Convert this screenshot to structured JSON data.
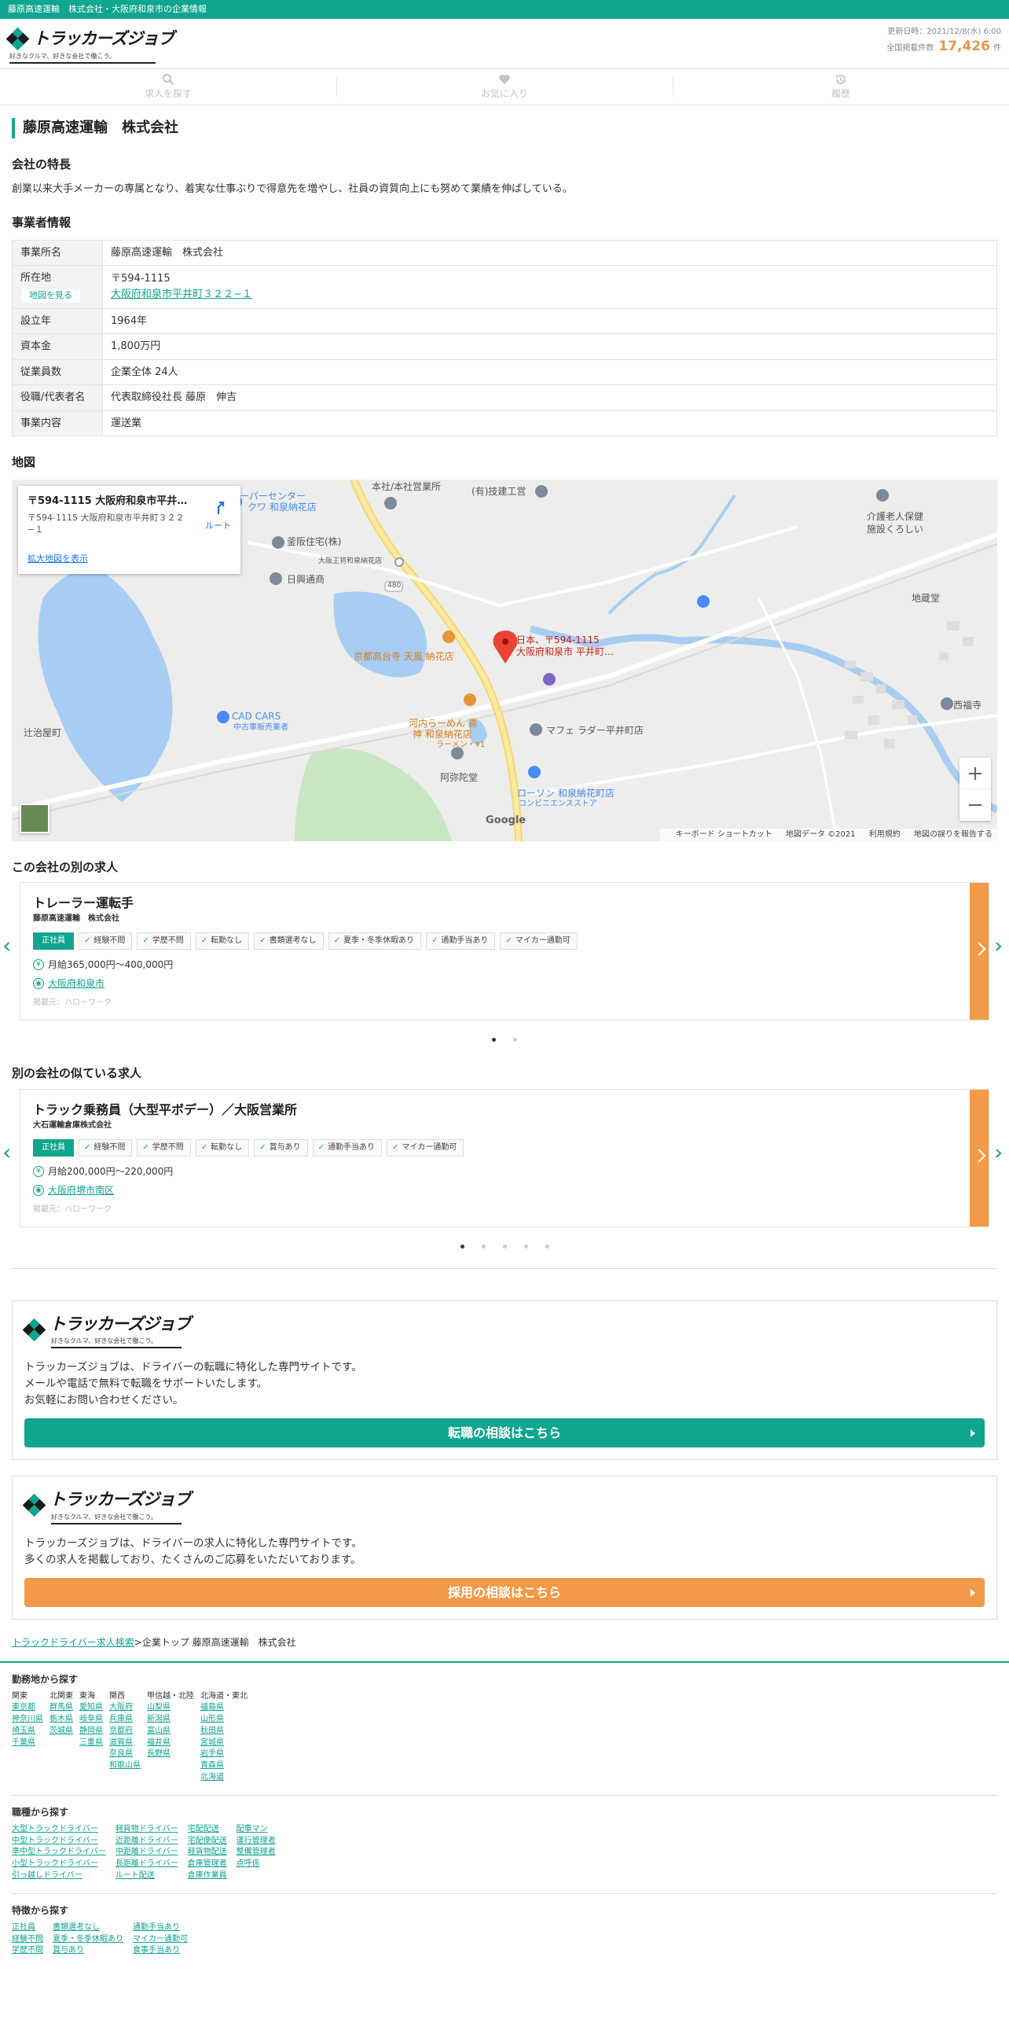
{
  "topbar": "藤原高速運輸　株式会社・大阪府和泉市の企業情報",
  "brand": {
    "name": "トラッカーズジョブ",
    "tagline": "好きなクルマ、好きな会社で働こう。",
    "colors": {
      "green": "#10a58f",
      "orange": "#f29a49",
      "dark": "#1a1a1a"
    }
  },
  "updated": {
    "label": "更新日時：2021/12/8(水) 6:00",
    "total_label": "全国掲載件数",
    "total": "17,426",
    "unit": "件"
  },
  "nav": [
    {
      "label": "求人を探す",
      "icon": "search-icon"
    },
    {
      "label": "お気に入り",
      "icon": "heart-icon"
    },
    {
      "label": "履歴",
      "icon": "history-icon"
    }
  ],
  "company": {
    "title": "藤原高速運輸　株式会社"
  },
  "feature": {
    "heading": "会社の特長",
    "text": "創業以来大手メーカーの専属となり、着実な仕事ぶりで得意先を増やし、社員の資質向上にも努めて業績を伸ばしている。"
  },
  "info": {
    "heading": "事業者情報",
    "rows": [
      {
        "label": "事業所名",
        "value": "藤原高速運輸　株式会社"
      },
      {
        "label": "所在地",
        "value": "〒594-1115",
        "link": "大阪府和泉市平井町３２２−１",
        "button": "地図を見る"
      },
      {
        "label": "設立年",
        "value": "1964年"
      },
      {
        "label": "資本金",
        "value": "1,800万円"
      },
      {
        "label": "従業員数",
        "value": "企業全体 24人"
      },
      {
        "label": "役職/代表者名",
        "value": "代表取締役社長 藤原　伸吉"
      },
      {
        "label": "事業内容",
        "value": "運送業"
      }
    ]
  },
  "map": {
    "heading": "地図",
    "card_title": "〒594-1115 大阪府和泉市平井町３２２−１",
    "card_address": "〒594-1115 大阪府和泉市平井町３２２−１",
    "card_large": "拡大地図を表示",
    "card_route": "ルート",
    "pin_label_1": "日本、〒594-1115",
    "pin_label_2": "大阪府和泉市 平井町…",
    "labels": {
      "honsha": "本社/本社営業所",
      "gikengyo": "(有)技建工営",
      "center": "ーパーセンター",
      "center2": "クワ 和泉納花店",
      "kamasaka": "釜阪住宅(株)",
      "daio": "大阪王将和泉納花店",
      "nikko": "日興通商",
      "kaigo1": "介護老人保健",
      "kaigo2": "施設くろしい",
      "jizo": "地蔵堂",
      "kyoto": "京都高台寺 天風 納花店",
      "kawachi1": "河内らーめん 喜",
      "kawachi2": "神 和泉納花店",
      "kawachi3": "ラーメン・¥1",
      "cadcars": "CAD CARS",
      "cadcars2": "中古車販売業者",
      "mafe": "マフェ ラダー平井町店",
      "nishi": "西福寺",
      "amida": "阿弥陀堂",
      "lawson": "ローソン 和泉納花町店",
      "lawson2": "コンビニエンスストア",
      "tsuji": "辻治屋町",
      "route480": "480"
    },
    "google": "Google",
    "attribution": [
      "キーボード ショートカット",
      "地図データ ©2021",
      "利用規約",
      "地図の誤りを報告する"
    ],
    "zoom_in": "+",
    "zoom_out": "−"
  },
  "other_jobs": {
    "heading": "この会社の別の求人",
    "title": "トレーラー運転手",
    "company": "藤原高速運輸　株式会社",
    "type": "正社員",
    "tags": [
      "経験不問",
      "学歴不問",
      "転勤なし",
      "書類選考なし",
      "夏季・冬季休暇あり",
      "通勤手当あり",
      "マイカー通勤可"
    ],
    "salary": "月給365,000円〜400,000円",
    "place": "大阪府和泉市",
    "source": "掲載元：ハローワーク",
    "dots": 2,
    "active_dot": 0
  },
  "similar_jobs": {
    "heading": "別の会社の似ている求人",
    "title": "トラック乗務員（大型平ボデー）／大阪営業所",
    "company": "大石運輸倉庫株式会社",
    "type": "正社員",
    "tags": [
      "経験不問",
      "学歴不問",
      "転勤なし",
      "賞与あり",
      "通勤手当あり",
      "マイカー通勤可"
    ],
    "salary": "月給200,000円〜220,000円",
    "place": "大阪府堺市南区",
    "source": "掲載元：ハローワーク",
    "dots": 5,
    "active_dot": 0
  },
  "promo1": {
    "lines": [
      "トラッカーズジョブは、ドライバーの転職に特化した専門サイトです。",
      "メールや電話で無料で転職をサポートいたします。",
      "お気軽にお問い合わせください。"
    ],
    "button": "転職の相談はこちら"
  },
  "promo2": {
    "lines": [
      "トラッカーズジョブは、ドライバーの求人に特化した専門サイトです。",
      "多くの求人を掲載しており、たくさんのご応募をいただいております。"
    ],
    "button": "採用の相談はこちら"
  },
  "breadcrumb": {
    "link": "トラックドライバー求人検索",
    "sep": ">",
    "rest": "企業トップ 藤原高速運輸　株式会社"
  },
  "footer": {
    "area_title": "勤務地から探す",
    "areas": [
      {
        "h": "関東",
        "items": [
          "東京都",
          "神奈川県",
          "埼玉県",
          "千葉県"
        ]
      },
      {
        "h": "北関東",
        "items": [
          "群馬県",
          "栃木県",
          "茨城県"
        ]
      },
      {
        "h": "東海",
        "items": [
          "愛知県",
          "岐阜県",
          "静岡県",
          "三重県"
        ]
      },
      {
        "h": "関西",
        "items": [
          "大阪府",
          "兵庫県",
          "京都府",
          "滋賀県",
          "奈良県",
          "和歌山県"
        ]
      },
      {
        "h": "甲信越・北陸",
        "items": [
          "山梨県",
          "新潟県",
          "富山県",
          "福井県",
          "長野県"
        ]
      },
      {
        "h": "北海道・東北",
        "items": [
          "福島県",
          "山形県",
          "秋田県",
          "宮城県",
          "岩手県",
          "青森県",
          "北海道"
        ]
      }
    ],
    "job_title": "職種から探す",
    "jobs": [
      [
        "大型トラックドライバー",
        "中型トラックドライバー",
        "準中型トラックドライバー",
        "小型トラックドライバー",
        "引っ越しドライバー"
      ],
      [
        "軽貨物ドライバー",
        "近距離ドライバー",
        "中距離ドライバー",
        "長距離ドライバー",
        "ルート配送"
      ],
      [
        "宅配配送",
        "宅配便配送",
        "軽貨物配送",
        "倉庫管理者",
        "倉庫作業員"
      ],
      [
        "配車マン",
        "運行管理者",
        "整備管理者",
        "点呼係"
      ]
    ],
    "feat_title": "特徴から探す",
    "feats": [
      [
        "正社員",
        "経験不問",
        "学歴不問"
      ],
      [
        "書類選考なし",
        "夏季・冬季休暇あり",
        "賞与あり"
      ],
      [
        "通勤手当あり",
        "マイカー通勤可",
        "食事手当あり"
      ]
    ]
  }
}
